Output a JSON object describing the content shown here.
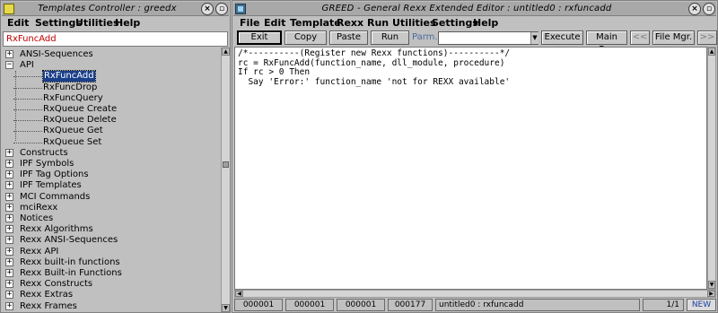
{
  "left_window": {
    "title": "Templates Controller : greedx",
    "menu": [
      "Edit",
      "Settings",
      "Utilities",
      "Help"
    ],
    "template_name": "RxFuncAdd",
    "tree": [
      {
        "label": "ANSI-Sequences",
        "expander": "+",
        "kind": "node"
      },
      {
        "label": "API",
        "expander": "−",
        "kind": "node"
      },
      {
        "label": "RxFuncAdd",
        "kind": "child",
        "selected": true
      },
      {
        "label": "RxFuncDrop",
        "kind": "child"
      },
      {
        "label": "RxFuncQuery",
        "kind": "child"
      },
      {
        "label": "RxQueue Create",
        "kind": "child"
      },
      {
        "label": "RxQueue Delete",
        "kind": "child"
      },
      {
        "label": "RxQueue Get",
        "kind": "child"
      },
      {
        "label": "RxQueue Set",
        "kind": "child"
      },
      {
        "label": "Constructs",
        "expander": "+",
        "kind": "node"
      },
      {
        "label": "IPF Symbols",
        "expander": "+",
        "kind": "node"
      },
      {
        "label": "IPF Tag Options",
        "expander": "+",
        "kind": "node"
      },
      {
        "label": "IPF Templates",
        "expander": "+",
        "kind": "node"
      },
      {
        "label": "MCI Commands",
        "expander": "+",
        "kind": "node"
      },
      {
        "label": "mciRexx",
        "expander": "+",
        "kind": "node"
      },
      {
        "label": "Notices",
        "expander": "+",
        "kind": "node"
      },
      {
        "label": "Rexx Algorithms",
        "expander": "+",
        "kind": "node"
      },
      {
        "label": "Rexx ANSI-Sequences",
        "expander": "+",
        "kind": "node"
      },
      {
        "label": "Rexx API",
        "expander": "+",
        "kind": "node"
      },
      {
        "label": "Rexx built-in functions",
        "expander": "+",
        "kind": "node"
      },
      {
        "label": "Rexx Built-in Functions",
        "expander": "+",
        "kind": "node"
      },
      {
        "label": "Rexx Constructs",
        "expander": "+",
        "kind": "node"
      },
      {
        "label": "Rexx Extras",
        "expander": "+",
        "kind": "node"
      },
      {
        "label": "Rexx Frames",
        "expander": "+",
        "kind": "node"
      }
    ]
  },
  "right_window": {
    "title": "GREED - General Rexx Extended Editor : untitled0 : rxfuncadd",
    "menu": [
      "File",
      "Edit",
      "Template",
      "Rexx",
      "Run",
      "Utilities",
      "Settings",
      "Help"
    ],
    "toolbar": {
      "exit": "Exit",
      "copy": "Copy",
      "paste": "Paste",
      "run": "Run",
      "parm_label": "Parm.",
      "parm_value": "",
      "execute": "Execute",
      "main_fnc": "Main Fnc",
      "prev": "<<",
      "file_mgr": "File Mgr.",
      "next": ">>"
    },
    "editor_lines": [
      "/*----------(Register new Rexx functions)----------*/",
      "rc = RxFuncAdd(function_name, dll_module, procedure)",
      "If rc > 0 Then",
      "  Say 'Error:' function_name 'not for REXX available'"
    ],
    "status": {
      "f1": "000001",
      "f2": "000001",
      "f3": "000001",
      "f4": "000177",
      "file": "untitled0 : rxfuncadd",
      "page": "1/1",
      "mode": "NEW"
    }
  },
  "colors": {
    "selection": "#1a3f8a",
    "template_name_text": "#c00000",
    "titlebar": "#a8a8a8",
    "mode_text": "#1a3fa0"
  }
}
